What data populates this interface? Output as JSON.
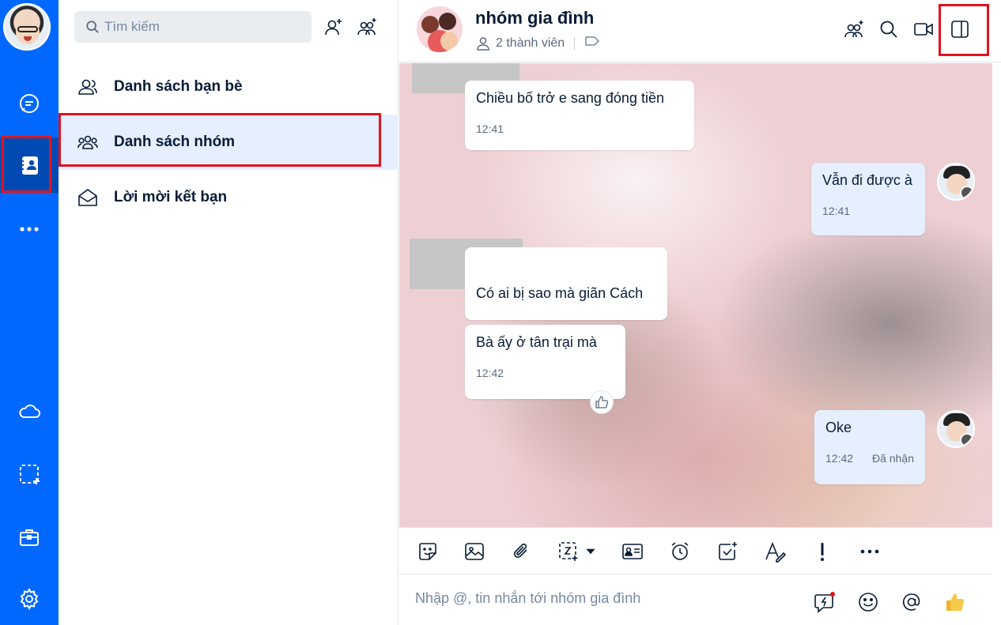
{
  "rail": {
    "items": [
      "messages-icon",
      "contacts-icon",
      "more-icon",
      "cloud-icon",
      "screenshot-icon",
      "briefcase-icon",
      "gear-icon"
    ],
    "active": "contacts-icon",
    "accent": "#0068ff"
  },
  "sidebar": {
    "search_placeholder": "Tìm kiếm",
    "menu": [
      {
        "label": "Danh sách bạn bè",
        "icon": "friends-icon"
      },
      {
        "label": "Danh sách nhóm",
        "icon": "groups-icon",
        "active": true
      },
      {
        "label": "Lời mời kết bạn",
        "icon": "envelope-open-icon"
      }
    ]
  },
  "chat": {
    "title": "nhóm gia đình",
    "members": "2 thành viên",
    "composer_placeholder": "Nhập @, tin nhắn tới nhóm gia đình",
    "messages": [
      {
        "side": "other",
        "text": "Chiều  bố trở e sang đóng tiền",
        "time": "12:41"
      },
      {
        "side": "me",
        "text": "Vẫn đi được à",
        "time": "12:41"
      },
      {
        "side": "other",
        "text": "Có  ai bị sao mà giãn Cách",
        "time": ""
      },
      {
        "side": "other",
        "text": "Bà  ấy ở  tân trại  mà",
        "time": "12:42"
      },
      {
        "side": "me",
        "text": "Oke",
        "time": "12:42",
        "status": "Đã nhận"
      }
    ]
  },
  "colors": {
    "highlight_box": "#e0141e",
    "my_bubble": "#e5efff",
    "active_menu": "#e5efff"
  }
}
